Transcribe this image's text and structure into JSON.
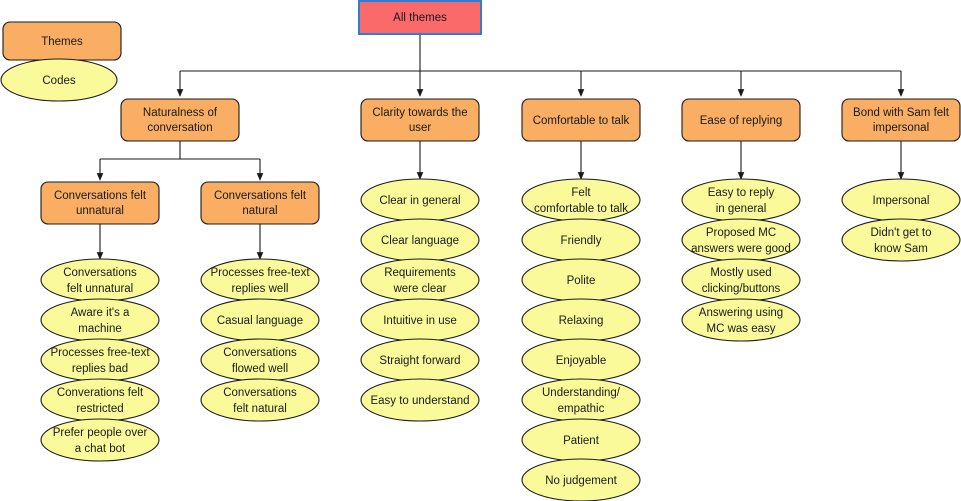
{
  "diagram": {
    "title": "All themes",
    "legend": {
      "theme_label": "Themes",
      "code_label": "Codes"
    },
    "colors": {
      "root_fill": "#fa6a6a",
      "root_stroke": "#2e7fd4",
      "theme_fill": "#f9ae63",
      "code_fill": "#fafa9b",
      "line": "#1a1a1a",
      "text": "#1a1a1a"
    },
    "root": {
      "label": "All themes"
    },
    "columns": [
      {
        "theme": "Naturalness of conversation",
        "subthemes": [
          {
            "label": "Conversations felt unnatural",
            "codes": [
              "Conversations felt unnatural",
              "Aware it's a machine",
              "Processes free-text replies bad",
              "Converations felt restricted",
              "Prefer people over a chat bot"
            ]
          },
          {
            "label": "Conversations felt natural",
            "codes": [
              "Processes free-text replies well",
              "Casual language",
              "Conversations flowed well",
              "Conversations felt natural"
            ]
          }
        ]
      },
      {
        "theme": "Clarity towards the user",
        "codes": [
          "Clear in general",
          "Clear language",
          "Requirements were clear",
          "Intuitive in use",
          "Straight forward",
          "Easy to understand"
        ]
      },
      {
        "theme": "Comfortable to talk",
        "codes": [
          "Felt comfortable to talk",
          "Friendly",
          "Polite",
          "Relaxing",
          "Enjoyable",
          "Understanding/ empathic",
          "Patient",
          "No judgement"
        ]
      },
      {
        "theme": "Ease of replying",
        "codes": [
          "Easy to reply in general",
          "Proposed MC answers were good",
          "Mostly used clicking/buttons",
          "Answering using MC was easy"
        ]
      },
      {
        "theme": "Bond with Sam felt impersonal",
        "codes": [
          "Impersonal",
          "Didn't get to know Sam"
        ]
      }
    ]
  }
}
